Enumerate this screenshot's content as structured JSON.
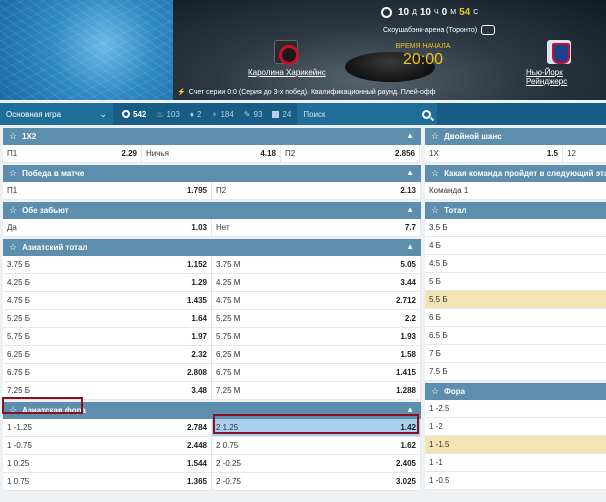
{
  "hero": {
    "timer": {
      "h": "10",
      "h_lbl": "Д",
      "m": "10",
      "m_lbl": "Ч",
      "s": "0",
      "s_lbl": "М",
      "sec": "54",
      "sec_lbl": "С"
    },
    "venue": "Скоушабэнк-арена (Торонто)",
    "start_label": "ВРЕМЯ НАЧАЛА",
    "start_time": "20:00",
    "home_team": "Каролина Харикейнс",
    "away_team": "Нью-Йорк Рейнджерс",
    "series_text": "Счет серии 0:0 (Серия до 3-х побед). Квалификационный раунд. Плей-офф"
  },
  "filter": {
    "select_value": "Основная игра",
    "counts": [
      {
        "icon": "target-icon",
        "value": "542"
      },
      {
        "icon": "fire-icon",
        "value": "103"
      },
      {
        "icon": "drop-icon",
        "value": "2"
      },
      {
        "icon": "basket-icon",
        "value": "184"
      },
      {
        "icon": "wrench-icon",
        "value": "93"
      },
      {
        "icon": "tv-icon",
        "value": "24"
      }
    ],
    "search_placeholder": "Поиск"
  },
  "left_markets": {
    "m1x2": {
      "title": "1X2",
      "row": {
        "a_k": "П1",
        "a_v": "2.29",
        "b_k": "Ничья",
        "b_v": "4.18",
        "c_k": "П2",
        "c_v": "2.856"
      }
    },
    "win": {
      "title": "Победа в матче",
      "row": {
        "a_k": "П1",
        "a_v": "1.795",
        "b_k": "П2",
        "b_v": "2.13"
      }
    },
    "btts": {
      "title": "Обе забьют",
      "row": {
        "a_k": "Да",
        "a_v": "1.03",
        "b_k": "Нет",
        "b_v": "7.7"
      }
    },
    "asian_total": {
      "title": "Азиатский тотал",
      "rows": [
        {
          "a_k": "3.75 Б",
          "a_v": "1.152",
          "b_k": "3.75 М",
          "b_v": "5.05"
        },
        {
          "a_k": "4.25 Б",
          "a_v": "1.29",
          "b_k": "4.25 М",
          "b_v": "3.44"
        },
        {
          "a_k": "4.75 Б",
          "a_v": "1.435",
          "b_k": "4.75 М",
          "b_v": "2.712"
        },
        {
          "a_k": "5.25 Б",
          "a_v": "1.64",
          "b_k": "5.25 М",
          "b_v": "2.2"
        },
        {
          "a_k": "5.75 Б",
          "a_v": "1.97",
          "b_k": "5.75 М",
          "b_v": "1.93"
        },
        {
          "a_k": "6.25 Б",
          "a_v": "2.32",
          "b_k": "6.25 М",
          "b_v": "1.58"
        },
        {
          "a_k": "6.75 Б",
          "a_v": "2.808",
          "b_k": "6.75 М",
          "b_v": "1.415"
        },
        {
          "a_k": "7.25 Б",
          "a_v": "3.48",
          "b_k": "7.25 М",
          "b_v": "1.288"
        }
      ]
    },
    "asian_handicap": {
      "title": "Азиатская фора",
      "rows": [
        {
          "a_k": "1 -1.25",
          "a_v": "2.784",
          "b_k": "2 1.25",
          "b_v": "1.42"
        },
        {
          "a_k": "1 -0.75",
          "a_v": "2.448",
          "b_k": "2 0.75",
          "b_v": "1.62"
        },
        {
          "a_k": "1 0.25",
          "a_v": "1.544",
          "b_k": "2 -0.25",
          "b_v": "2.405"
        },
        {
          "a_k": "1 0.75",
          "a_v": "1.365",
          "b_k": "2 -0.75",
          "b_v": "3.025"
        }
      ]
    }
  },
  "right_markets": {
    "double": {
      "title": "Двойной шанс",
      "row": {
        "a_k": "1X",
        "a_v": "1.5",
        "b_k": "12"
      }
    },
    "advance": {
      "title": "Какая команда пройдет в следующий этап",
      "row": {
        "a_k": "Команда 1"
      }
    },
    "total": {
      "title": "Тотал",
      "rows": [
        "3.5 Б",
        "4 Б",
        "4.5 Б",
        "5 Б",
        "5.5 Б",
        "6 Б",
        "6.5 Б",
        "7 Б",
        "7.5 Б"
      ]
    },
    "handicap": {
      "title": "Фора",
      "rows": [
        "1 -2.5",
        "1 -2",
        "1 -1.5",
        "1 -1",
        "1 -0.5"
      ]
    }
  },
  "colors": {
    "accent": "#185d86",
    "market_header": "#5d8eae",
    "highlight": "#a8d0ee",
    "tan": "#f3e4b3",
    "box_red": "#8b1120"
  }
}
